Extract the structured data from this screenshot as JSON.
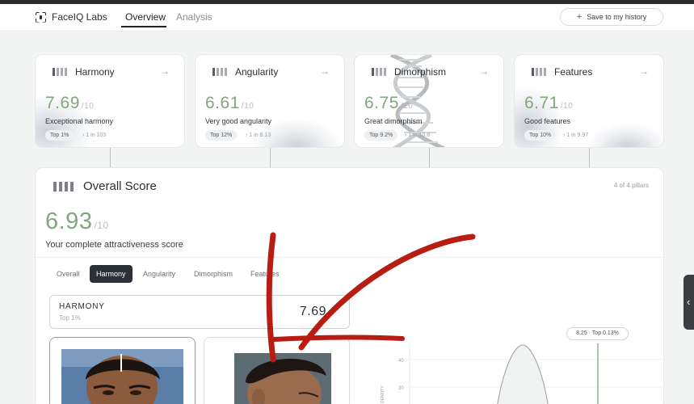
{
  "nav": {
    "logo_text": "FaceIQ Labs",
    "tabs": [
      "Overview",
      "Analysis"
    ],
    "save_label": "Save to my history"
  },
  "cards": [
    {
      "title": "Harmony",
      "score": "7.69",
      "scale": "/10",
      "desc": "Exceptional harmony",
      "pill": "Top 1%",
      "rank": "› 1 in 103"
    },
    {
      "title": "Angularity",
      "score": "6.61",
      "scale": "/10",
      "desc": "Very good angularity",
      "pill": "Top 12%",
      "rank": "› 1 in 8.13"
    },
    {
      "title": "Dimorphism",
      "score": "6.75",
      "scale": "/10",
      "desc": "Great dimorphism",
      "pill": "Top 9.2%",
      "rank": "› 1 in 10.8"
    },
    {
      "title": "Features",
      "score": "6.71",
      "scale": "/10",
      "desc": "Good features",
      "pill": "Top 10%",
      "rank": "› 1 in 9.97"
    }
  ],
  "overall": {
    "title": "Overall Score",
    "pillars": "4 of 4 pillars",
    "score": "6.93",
    "scale": "/10",
    "subtitle": "Your complete attractiveness score"
  },
  "subtabs": [
    "Overall",
    "Harmony",
    "Angularity",
    "Dimorphism",
    "Features"
  ],
  "harmony_box": {
    "label": "HARMONY",
    "sub": "Top 1%",
    "value": "7.69"
  },
  "density_chart": {
    "tooltip": "8.25 · Top 0.13%",
    "y_ticks": [
      "40",
      "30"
    ],
    "y_label": "DENSITY"
  },
  "colors": {
    "score_green": "#7fa97a",
    "annotation_red": "#b81d14",
    "active_tab": "#2b3136"
  },
  "icons": {
    "save": "plus-icon",
    "card_arrow": "arrow-right-icon",
    "handle": "chevron-left-icon"
  }
}
